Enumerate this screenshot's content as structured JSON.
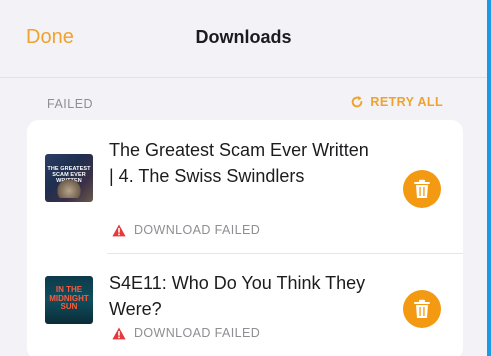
{
  "nav": {
    "done_label": "Done",
    "title": "Downloads"
  },
  "section": {
    "label": "FAILED",
    "retry_label": "RETRY ALL"
  },
  "downloads": [
    {
      "title": "The Greatest Scam Ever Written | 4. The Swiss Swindlers",
      "status": "DOWNLOAD FAILED",
      "artwork_text": "THE GREATEST SCAM EVER WRITTEN"
    },
    {
      "title": "S4E11: Who Do You Think They Were?",
      "status": "DOWNLOAD FAILED",
      "artwork_text": "IN THE MIDNIGHT SUN"
    }
  ],
  "colors": {
    "accent": "#f0a22e",
    "delete_button": "#f39a12",
    "error": "#e5393b",
    "secondary_text": "#8e8e93",
    "side_strip": "#1a9be8"
  },
  "icons": {
    "retry": "retry-icon",
    "warning": "warning-icon",
    "delete": "trash-icon"
  }
}
